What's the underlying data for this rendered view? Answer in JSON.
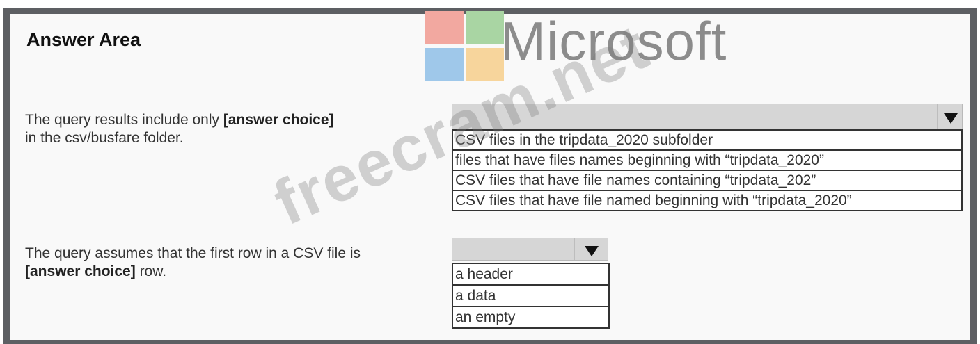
{
  "top_text": "...... . . . . .. . . .. . . . .. . . . . . ...",
  "title": "Answer Area",
  "watermark": {
    "logo_word": "Microsoft",
    "site": "freecram.net"
  },
  "questions": [
    {
      "text_before": "The query results include only ",
      "choice_label": "[answer choice]",
      "text_after": " in the csv/busfare folder.",
      "selected": "",
      "options": [
        "CSV files in the tripdata_2020 subfolder",
        "files that have files names beginning with “tripdata_2020”",
        "CSV files that have file names containing “tripdata_202”",
        "CSV files that have file named beginning with “tripdata_2020”"
      ]
    },
    {
      "text_before": "The query assumes that the first row in a CSV file is ",
      "choice_label": "[answer choice]",
      "text_after": " row.",
      "selected": "",
      "options": [
        "a header",
        "a data",
        "an empty"
      ]
    }
  ],
  "icons": {
    "dropdown": "dropdown-arrow-icon"
  },
  "colors": {
    "frame": "#5d5f63",
    "panel": "#f9f9f9",
    "select": "#d6d6d6",
    "logo": [
      "#f2a8a0",
      "#a9d5a3",
      "#9fc8ea",
      "#f7d59c"
    ]
  }
}
